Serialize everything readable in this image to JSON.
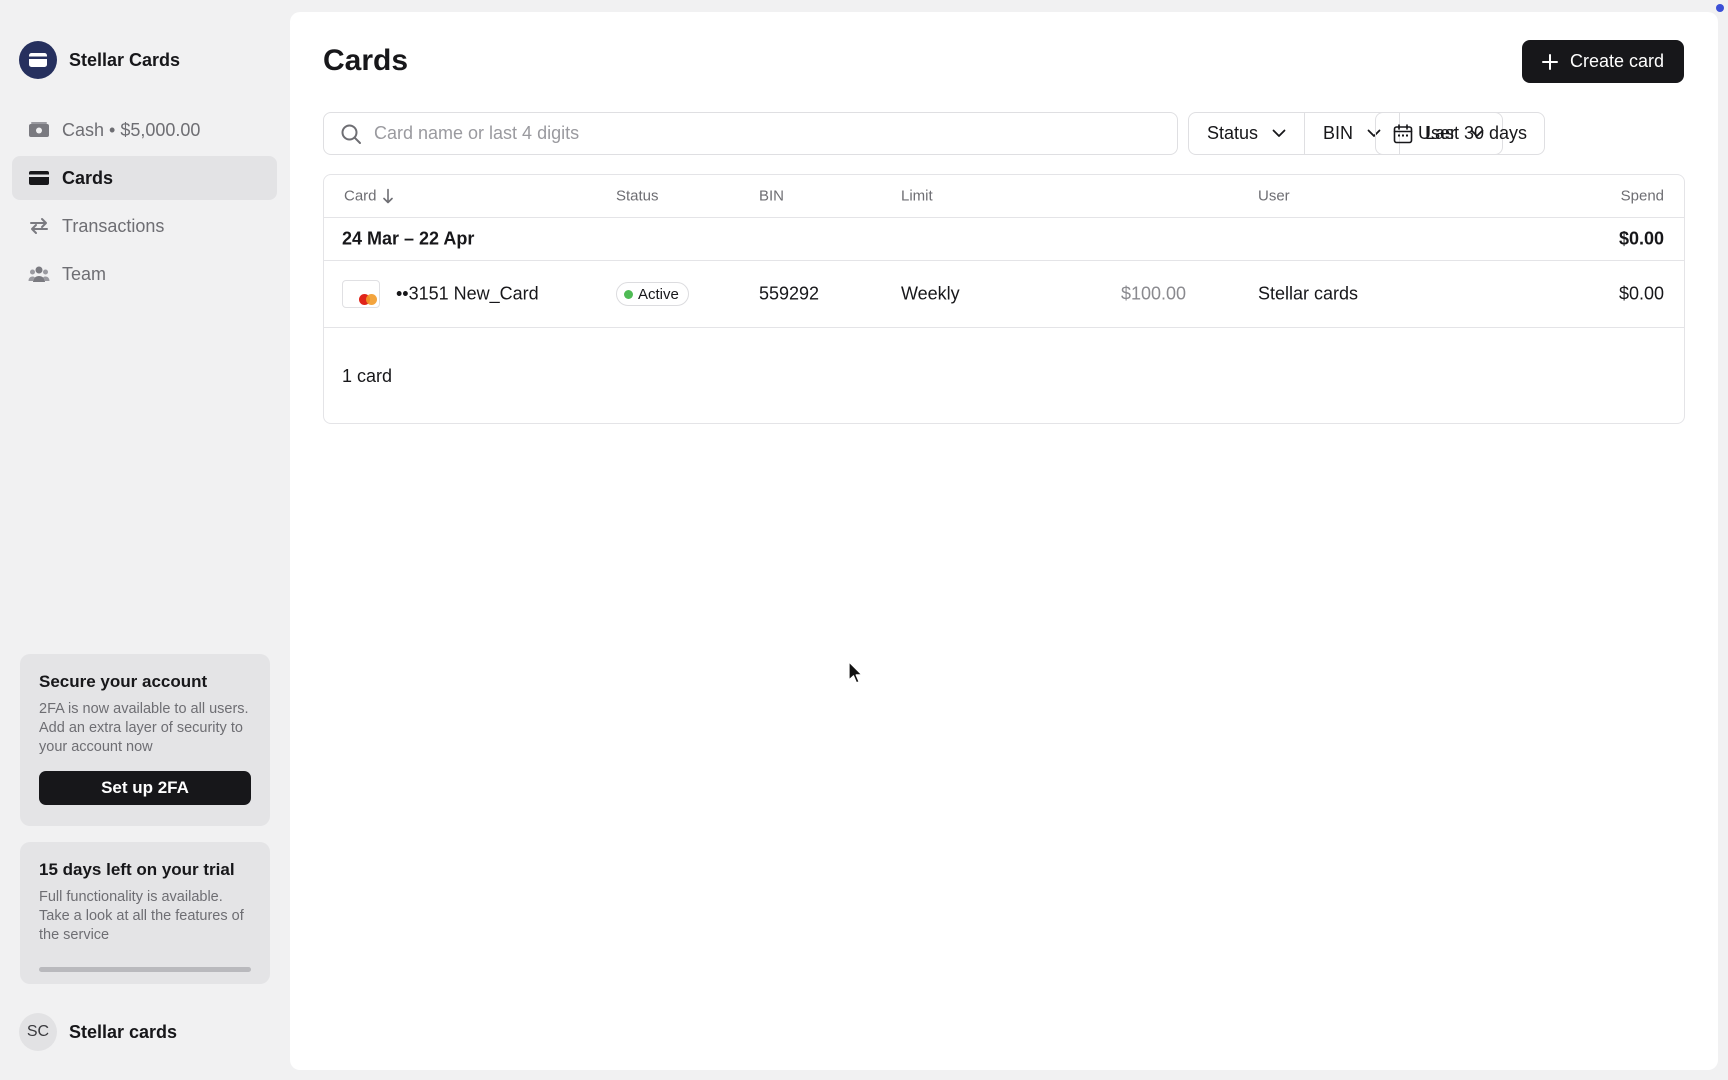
{
  "sidebar": {
    "brand": "Stellar Cards",
    "items": [
      {
        "label": "Cash • $5,000.00",
        "icon": "cash-icon"
      },
      {
        "label": "Cards",
        "icon": "card-icon",
        "active": true
      },
      {
        "label": "Transactions",
        "icon": "transactions-icon"
      },
      {
        "label": "Team",
        "icon": "team-icon"
      }
    ],
    "security_panel": {
      "title": "Secure your account",
      "text": "2FA is now available to all users. Add an extra layer of security to your account now",
      "button": "Set up 2FA"
    },
    "trial_panel": {
      "title": "15 days left on your trial",
      "text": "Full functionality is available. Take a look at all the features of the service",
      "progress": 1.0
    },
    "user": {
      "initials": "SC",
      "name": "Stellar cards"
    }
  },
  "main": {
    "title": "Cards",
    "create_button": "Create card",
    "search": {
      "placeholder": "Card name or last 4 digits",
      "value": ""
    },
    "filters": [
      "Status",
      "BIN",
      "User"
    ],
    "date_range": "Last 30 days",
    "table": {
      "columns": {
        "card": "Card",
        "status": "Status",
        "bin": "BIN",
        "limit": "Limit",
        "user": "User",
        "spend": "Spend"
      },
      "group": {
        "label": "24 Mar – 22 Apr",
        "total": "$0.00"
      },
      "rows": [
        {
          "card": "••3151 New_Card",
          "status": "Active",
          "bin": "559292",
          "limit_period": "Weekly",
          "limit_amount": "$100.00",
          "user": "Stellar cards",
          "spend": "$0.00"
        }
      ],
      "footer": "1 card"
    }
  },
  "colors": {
    "accent": "#17171a",
    "brand_logo": "#26305e",
    "status_active": "#4fbb55",
    "mastercard_red": "#e0241a",
    "mastercard_orange": "#f29a28"
  }
}
